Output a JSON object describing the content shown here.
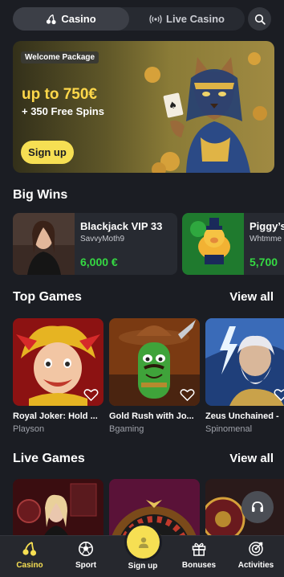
{
  "header": {
    "tabs": [
      {
        "label": "Casino",
        "icon": "cherries-icon",
        "active": true
      },
      {
        "label": "Live Casino",
        "icon": "live-broadcast-icon",
        "active": false
      }
    ],
    "search_icon": "search-icon"
  },
  "promo": {
    "badge": "Welcome Package",
    "amount": "up to 750€",
    "spins": "+ 350 Free Spins",
    "cta": "Sign up"
  },
  "big_wins": {
    "title": "Big Wins",
    "items": [
      {
        "game": "Blackjack VIP 33",
        "user": "SavvyMoth9",
        "amount": "6,000 €"
      },
      {
        "game": "Piggy’s",
        "user": "Whtmme",
        "amount": "5,700"
      }
    ]
  },
  "top_games": {
    "title": "Top Games",
    "view_all": "View all",
    "items": [
      {
        "name": "Royal Joker: Hold ...",
        "provider": "Playson"
      },
      {
        "name": "Gold Rush with Jo...",
        "provider": "Bgaming"
      },
      {
        "name": "Zeus Unchained -",
        "provider": "Spinomenal"
      }
    ]
  },
  "live_games": {
    "title": "Live Games",
    "view_all": "View all"
  },
  "bottom_nav": {
    "items": [
      {
        "label": "Casino",
        "icon": "cherries-icon",
        "active": true
      },
      {
        "label": "Sport",
        "icon": "soccer-ball-icon",
        "active": false
      },
      {
        "label": "Sign up",
        "icon": "user-icon",
        "active": false
      },
      {
        "label": "Bonuses",
        "icon": "gift-icon",
        "active": false
      },
      {
        "label": "Activities",
        "icon": "target-icon",
        "active": false
      }
    ]
  },
  "colors": {
    "background": "#1b1d23",
    "accent_yellow": "#f6df53",
    "win_green": "#35d943"
  }
}
